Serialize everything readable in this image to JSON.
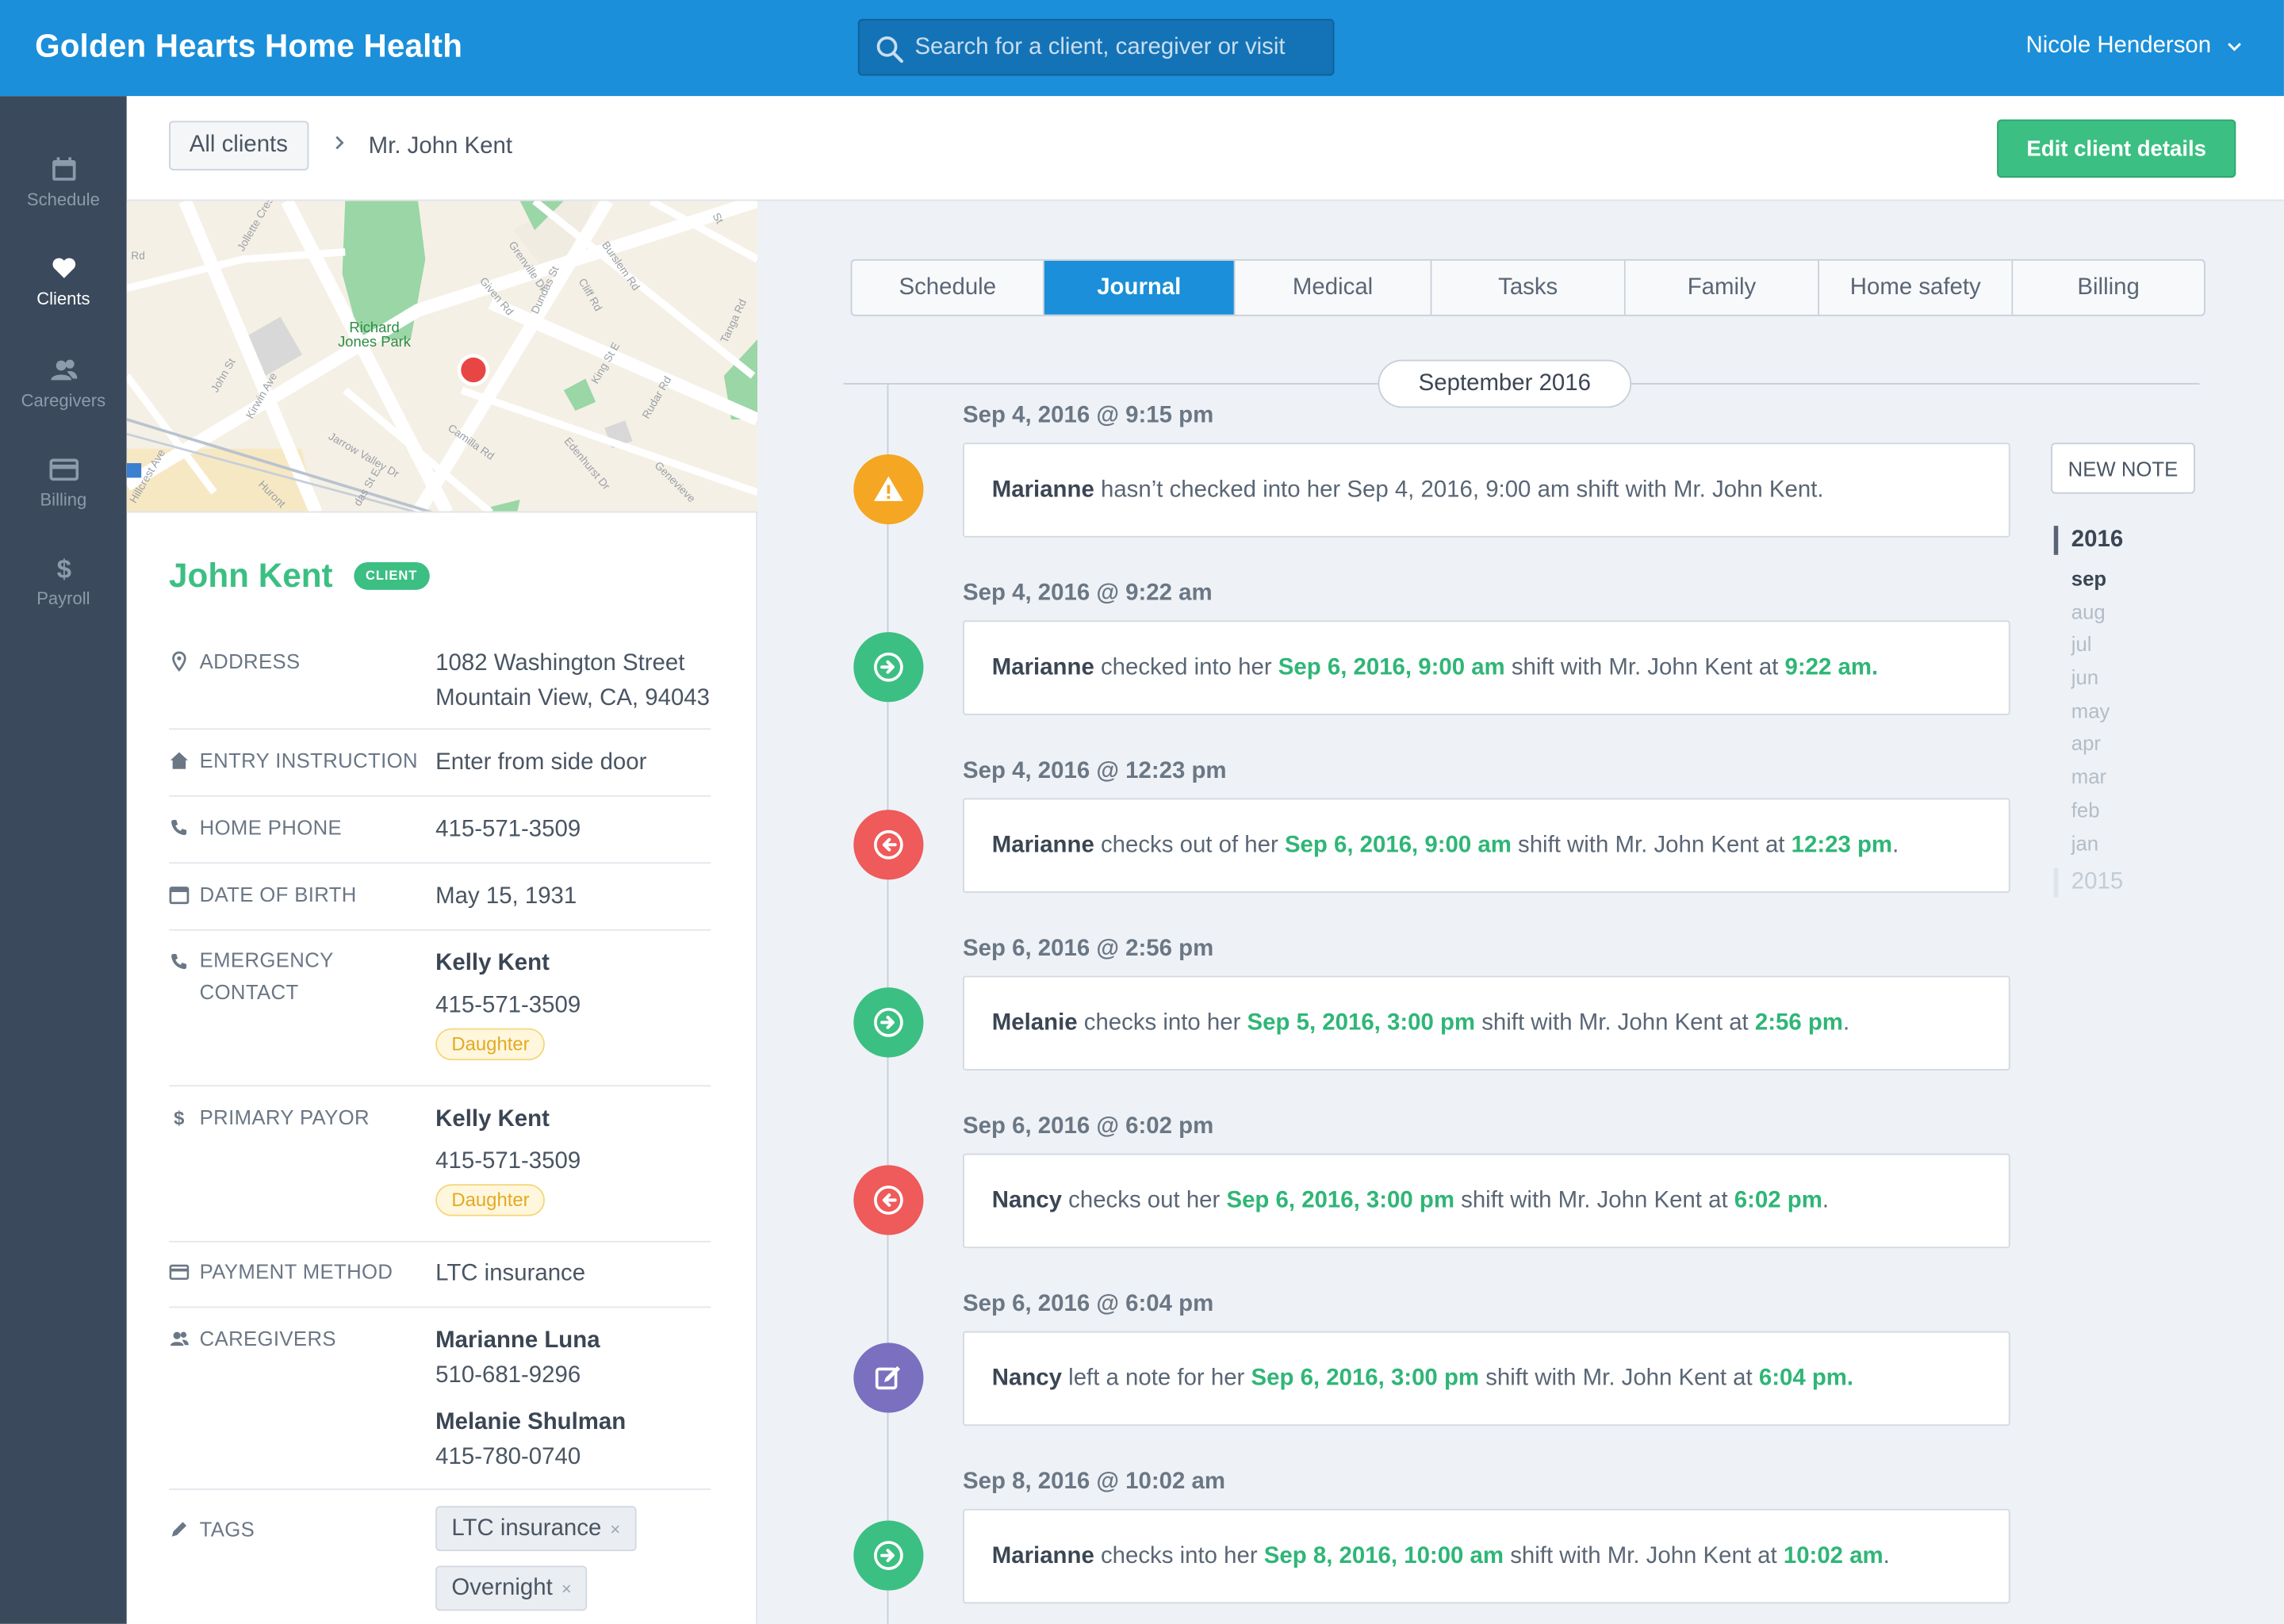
{
  "app": {
    "brand": "Golden Hearts Home Health"
  },
  "search": {
    "placeholder": "Search for a client, caregiver or visit"
  },
  "user": {
    "name": "Nicole Henderson"
  },
  "nav": [
    {
      "label": "Schedule",
      "icon": "calendar-icon"
    },
    {
      "label": "Clients",
      "icon": "heart-icon"
    },
    {
      "label": "Caregivers",
      "icon": "users-icon"
    },
    {
      "label": "Billing",
      "icon": "credit-card-icon"
    },
    {
      "label": "Payroll",
      "icon": "dollar-icon"
    }
  ],
  "breadcrumb": {
    "all": "All clients",
    "current": "Mr. John Kent"
  },
  "actions": {
    "edit": "Edit client details",
    "new_note": "NEW NOTE"
  },
  "map": {
    "park_label": "Richard Jones Park",
    "streets": [
      "Jollette Cres",
      "Grenville Dr",
      "Burslem Rd",
      "St",
      "Dundas St",
      "Cliff Rd",
      "Given Rd",
      "King St E",
      "Tanga Rd",
      "John St",
      "Kirwin Ave",
      "Jarrow Valley Dr",
      "Camilla Rd",
      "Edenhurst Dr",
      "Genevieve",
      "Rudar Rd",
      "Hillcrest Ave",
      "Huront",
      "das St E",
      "Rd"
    ]
  },
  "client": {
    "name": "John Kent",
    "badge": "CLIENT",
    "labels": {
      "address": "ADDRESS",
      "entry": "ENTRY INSTRUCTION",
      "home_phone": "HOME PHONE",
      "dob": "DATE OF BIRTH",
      "emergency_1": "EMERGENCY",
      "emergency_2": "CONTACT",
      "payor": "PRIMARY PAYOR",
      "payment": "PAYMENT METHOD",
      "caregivers": "CAREGIVERS",
      "tags": "TAGS"
    },
    "address_line1": "1082 Washington Street",
    "address_line2": "Mountain View, CA, 94043",
    "entry": "Enter from side door",
    "home_phone": "415-571-3509",
    "dob": "May 15, 1931",
    "emergency": {
      "name": "Kelly Kent",
      "phone": "415-571-3509",
      "relation": "Daughter"
    },
    "payor": {
      "name": "Kelly Kent",
      "phone": "415-571-3509",
      "relation": "Daughter"
    },
    "payment": "LTC insurance",
    "caregivers": [
      {
        "name": "Marianne Luna",
        "phone": "510-681-9296"
      },
      {
        "name": "Melanie Shulman",
        "phone": "415-780-0740"
      }
    ],
    "tags": [
      "LTC insurance",
      "Overnight"
    ],
    "tag_remove": "×"
  },
  "tabs": [
    "Schedule",
    "Journal",
    "Medical",
    "Tasks",
    "Family",
    "Home safety",
    "Billing"
  ],
  "active_tab": "Journal",
  "month": "September 2016",
  "entries": [
    {
      "date": "Sep 4, 2016 @ 9:15 pm",
      "kind": "warning",
      "parts": [
        [
          "b",
          "Marianne"
        ],
        [
          "t",
          " hasn’t checked into her Sep 4, 2016, 9:00 am shift with Mr. John Kent."
        ]
      ]
    },
    {
      "date": "Sep 4, 2016 @ 9:22 am",
      "kind": "check-in",
      "parts": [
        [
          "b",
          "Marianne"
        ],
        [
          "t",
          " checked into her "
        ],
        [
          "h",
          "Sep 6, 2016, 9:00 am"
        ],
        [
          "t",
          " shift with Mr. John Kent at "
        ],
        [
          "h",
          "9:22 am."
        ]
      ]
    },
    {
      "date": "Sep 4, 2016 @ 12:23 pm",
      "kind": "check-out",
      "parts": [
        [
          "b",
          "Marianne"
        ],
        [
          "t",
          " checks out of her "
        ],
        [
          "h",
          "Sep 6, 2016, 9:00 am"
        ],
        [
          "t",
          " shift with Mr. John Kent at "
        ],
        [
          "h",
          "12:23 pm"
        ],
        [
          "t",
          "."
        ]
      ]
    },
    {
      "date": "Sep 6, 2016 @ 2:56 pm",
      "kind": "check-in",
      "parts": [
        [
          "b",
          "Melanie"
        ],
        [
          "t",
          " checks into her "
        ],
        [
          "h",
          "Sep 5, 2016, 3:00 pm"
        ],
        [
          "t",
          " shift with Mr. John Kent at "
        ],
        [
          "h",
          "2:56 pm"
        ],
        [
          "t",
          "."
        ]
      ]
    },
    {
      "date": "Sep 6, 2016 @ 6:02 pm",
      "kind": "check-out",
      "parts": [
        [
          "b",
          "Nancy"
        ],
        [
          "t",
          " checks out her "
        ],
        [
          "h",
          "Sep 6, 2016, 3:00 pm"
        ],
        [
          "t",
          " shift with Mr. John Kent at "
        ],
        [
          "h",
          "6:02 pm"
        ],
        [
          "t",
          "."
        ]
      ]
    },
    {
      "date": "Sep 6, 2016 @ 6:04 pm",
      "kind": "note",
      "parts": [
        [
          "b",
          "Nancy"
        ],
        [
          "t",
          " left a note for her "
        ],
        [
          "h",
          "Sep 6, 2016, 3:00 pm"
        ],
        [
          "t",
          " shift with Mr. John Kent at "
        ],
        [
          "h",
          "6:04 pm."
        ]
      ]
    },
    {
      "date": "Sep 8, 2016 @ 10:02 am",
      "kind": "check-in",
      "parts": [
        [
          "b",
          "Marianne"
        ],
        [
          "t",
          " checks into her "
        ],
        [
          "h",
          "Sep 8, 2016, 10:00 am"
        ],
        [
          "t",
          " shift with Mr. John Kent at "
        ],
        [
          "h",
          "10:02 am"
        ],
        [
          "t",
          "."
        ]
      ]
    }
  ],
  "archive": {
    "year": "2016",
    "months": [
      "sep",
      "aug",
      "jul",
      "jun",
      "may",
      "apr",
      "mar",
      "feb",
      "jan"
    ],
    "active_month": "sep",
    "prev_year": "2015"
  },
  "colors": {
    "brand": "#1b8fd9",
    "accent": "#3cbf82",
    "warning": "#f5a623",
    "danger": "#ef5a5a",
    "note": "#7b6fc0"
  }
}
